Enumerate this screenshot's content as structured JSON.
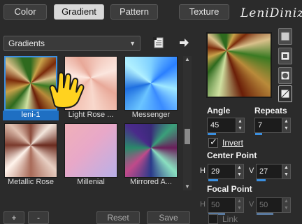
{
  "tabs": [
    {
      "label": "Color",
      "active": false
    },
    {
      "label": "Gradient",
      "active": true
    },
    {
      "label": "Pattern",
      "active": false
    },
    {
      "label": "Texture",
      "active": false
    }
  ],
  "logo": "LeniDiniz",
  "dropdown": {
    "value": "Gradients"
  },
  "gradients": [
    {
      "label": "leni-1",
      "selected": true
    },
    {
      "label": "Light Rose ...",
      "selected": false
    },
    {
      "label": "Messenger",
      "selected": false
    },
    {
      "label": "Metallic Rose",
      "selected": false
    },
    {
      "label": "Millenial",
      "selected": false
    },
    {
      "label": "Mirrored A...",
      "selected": false
    }
  ],
  "bottom_buttons": {
    "add": "+",
    "remove": "-",
    "reset": "Reset",
    "save": "Save"
  },
  "angle": {
    "label": "Angle",
    "value": "45"
  },
  "repeats": {
    "label": "Repeats",
    "value": "7"
  },
  "invert": {
    "label": "Invert",
    "checked": true
  },
  "center_point": {
    "label": "Center Point",
    "h_label": "H",
    "h_value": "29",
    "v_label": "V",
    "v_value": "27"
  },
  "focal_point": {
    "label": "Focal Point",
    "h_label": "H",
    "h_value": "50",
    "v_label": "V",
    "v_value": "50"
  },
  "link": {
    "label": "Link",
    "checked": false
  },
  "colors": {
    "accent": "#3b8fe0",
    "background": "#2b2b2b"
  }
}
